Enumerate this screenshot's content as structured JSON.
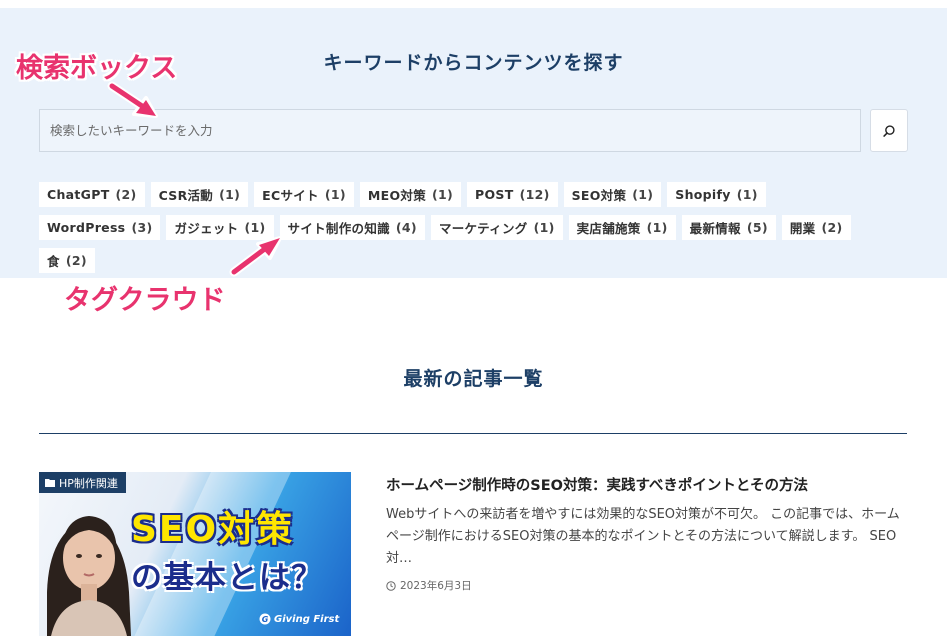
{
  "search": {
    "title": "キーワードからコンテンツを探す",
    "placeholder": "検索したいキーワードを入力"
  },
  "tags": [
    {
      "name": "ChatGPT",
      "count": "(2)"
    },
    {
      "name": "CSR活動",
      "count": "(1)"
    },
    {
      "name": "ECサイト",
      "count": "(1)"
    },
    {
      "name": "MEO対策",
      "count": "(1)"
    },
    {
      "name": "POST",
      "count": "(12)"
    },
    {
      "name": "SEO対策",
      "count": "(1)"
    },
    {
      "name": "Shopify",
      "count": "(1)"
    },
    {
      "name": "WordPress",
      "count": "(3)"
    },
    {
      "name": "ガジェット",
      "count": "(1)"
    },
    {
      "name": "サイト制作の知識",
      "count": "(4)"
    },
    {
      "name": "マーケティング",
      "count": "(1)"
    },
    {
      "name": "実店舗施策",
      "count": "(1)"
    },
    {
      "name": "最新情報",
      "count": "(5)"
    },
    {
      "name": "開業",
      "count": "(2)"
    },
    {
      "name": "食",
      "count": "(2)"
    }
  ],
  "annotations": {
    "search_box": "検索ボックス",
    "tag_cloud": "タグクラウド",
    "color": "#e8336e"
  },
  "latest": {
    "title": "最新の記事一覧"
  },
  "article": {
    "category": "HP制作関連",
    "thumb_line1": "SEO対策",
    "thumb_line2": "の基本とは？",
    "thumb_brand": "Giving First",
    "title": "ホームページ制作時のSEO対策：実践すべきポイントとその方法",
    "excerpt": "Webサイトへの来訪者を増やすには効果的なSEO対策が不可欠。 この記事では、ホームページ制作におけるSEO対策の基本的なポイントとその方法について解説します。 SEO対…",
    "date": "2023年6月3日"
  },
  "colors": {
    "accent": "#1d3f66",
    "panel": "#eaf2fb"
  }
}
